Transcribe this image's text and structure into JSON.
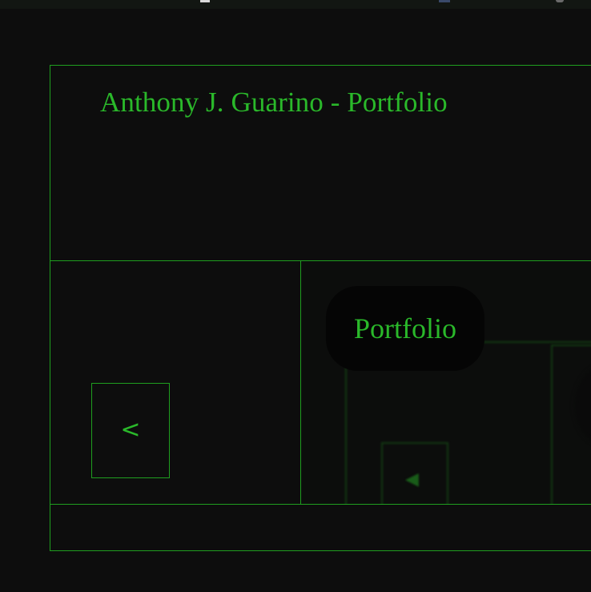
{
  "page": {
    "title": "Anthony J. Guarino - Portfolio"
  },
  "nav": {
    "back_label": "<"
  },
  "preview": {
    "label": "Portfolio"
  },
  "colors": {
    "background": "#0d0d0d",
    "accent": "#2ab82a",
    "border": "#1f9e1f"
  }
}
